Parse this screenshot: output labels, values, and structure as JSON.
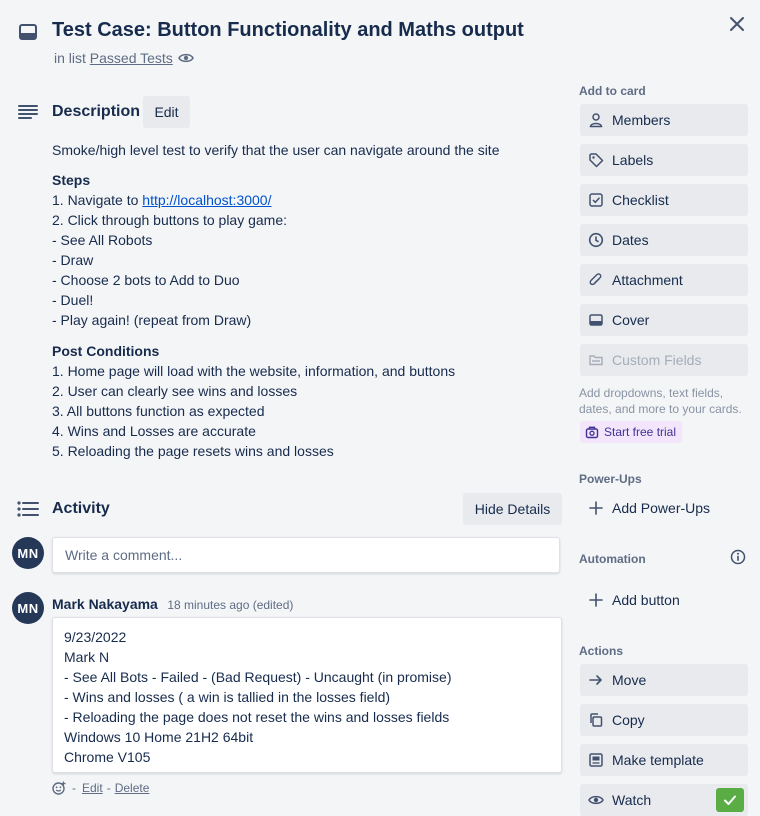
{
  "card": {
    "title": "Test Case: Button Functionality and Maths output",
    "in_list_prefix": "in list",
    "list_name": "Passed Tests"
  },
  "description": {
    "heading": "Description",
    "edit_label": "Edit",
    "intro": "Smoke/high level test to verify that the user can navigate around the site",
    "steps_heading": "Steps",
    "step1_prefix": "1. Navigate to ",
    "step1_link": "http://localhost:3000/",
    "steps": [
      "2. Click through buttons to play game:",
      "- See All Robots",
      "- Draw",
      "- Choose 2 bots to Add to Duo",
      "- Duel!",
      "- Play again! (repeat from Draw)"
    ],
    "post_heading": "Post Conditions",
    "post": [
      "1. Home page will load with the website, information, and buttons",
      "2. User can clearly see wins and losses",
      "3. All buttons function as expected",
      "4. Wins and Losses are accurate",
      "5. Reloading the page resets wins and losses"
    ]
  },
  "activity": {
    "heading": "Activity",
    "hide_details_label": "Hide Details",
    "avatar_initials": "MN",
    "comment_placeholder": "Write a comment...",
    "comment": {
      "author": "Mark Nakayama",
      "time": "18 minutes ago (edited)",
      "lines": [
        "9/23/2022",
        "Mark N",
        "- See All Bots - Failed - (Bad Request) - Uncaught (in promise)",
        "- Wins and losses ( a win is tallied in the losses field)",
        "- Reloading the page does not reset the wins and losses fields",
        "Windows 10 Home 21H2 64bit",
        "Chrome V105"
      ],
      "sep1": "-",
      "edit_label": "Edit",
      "sep2": "-",
      "delete_label": "Delete"
    }
  },
  "sidebar": {
    "add_to_card_label": "Add to card",
    "add_to_card": [
      {
        "label": "Members",
        "icon": "person-icon"
      },
      {
        "label": "Labels",
        "icon": "tag-icon"
      },
      {
        "label": "Checklist",
        "icon": "checkbox-icon"
      },
      {
        "label": "Dates",
        "icon": "clock-icon"
      },
      {
        "label": "Attachment",
        "icon": "paperclip-icon"
      },
      {
        "label": "Cover",
        "icon": "card-icon"
      },
      {
        "label": "Custom Fields",
        "icon": "field-icon"
      }
    ],
    "custom_fields_note": "Add dropdowns, text fields, dates, and more to your cards.",
    "start_trial_label": "Start free trial",
    "powerups_label": "Power-Ups",
    "add_powerups_label": "Add Power-Ups",
    "automation_label": "Automation",
    "add_button_label": "Add button",
    "actions_label": "Actions",
    "actions": [
      {
        "label": "Move",
        "icon": "arrow-right-icon"
      },
      {
        "label": "Copy",
        "icon": "copy-icon"
      },
      {
        "label": "Make template",
        "icon": "template-icon"
      },
      {
        "label": "Watch",
        "icon": "eye-icon"
      }
    ]
  },
  "colors": {
    "background": "#f4f5f7",
    "button": "#e8eaed",
    "avatar": "#253858",
    "link": "#0052cc",
    "watch_check": "#5aac44",
    "trial_bg": "#f3e5fb"
  }
}
